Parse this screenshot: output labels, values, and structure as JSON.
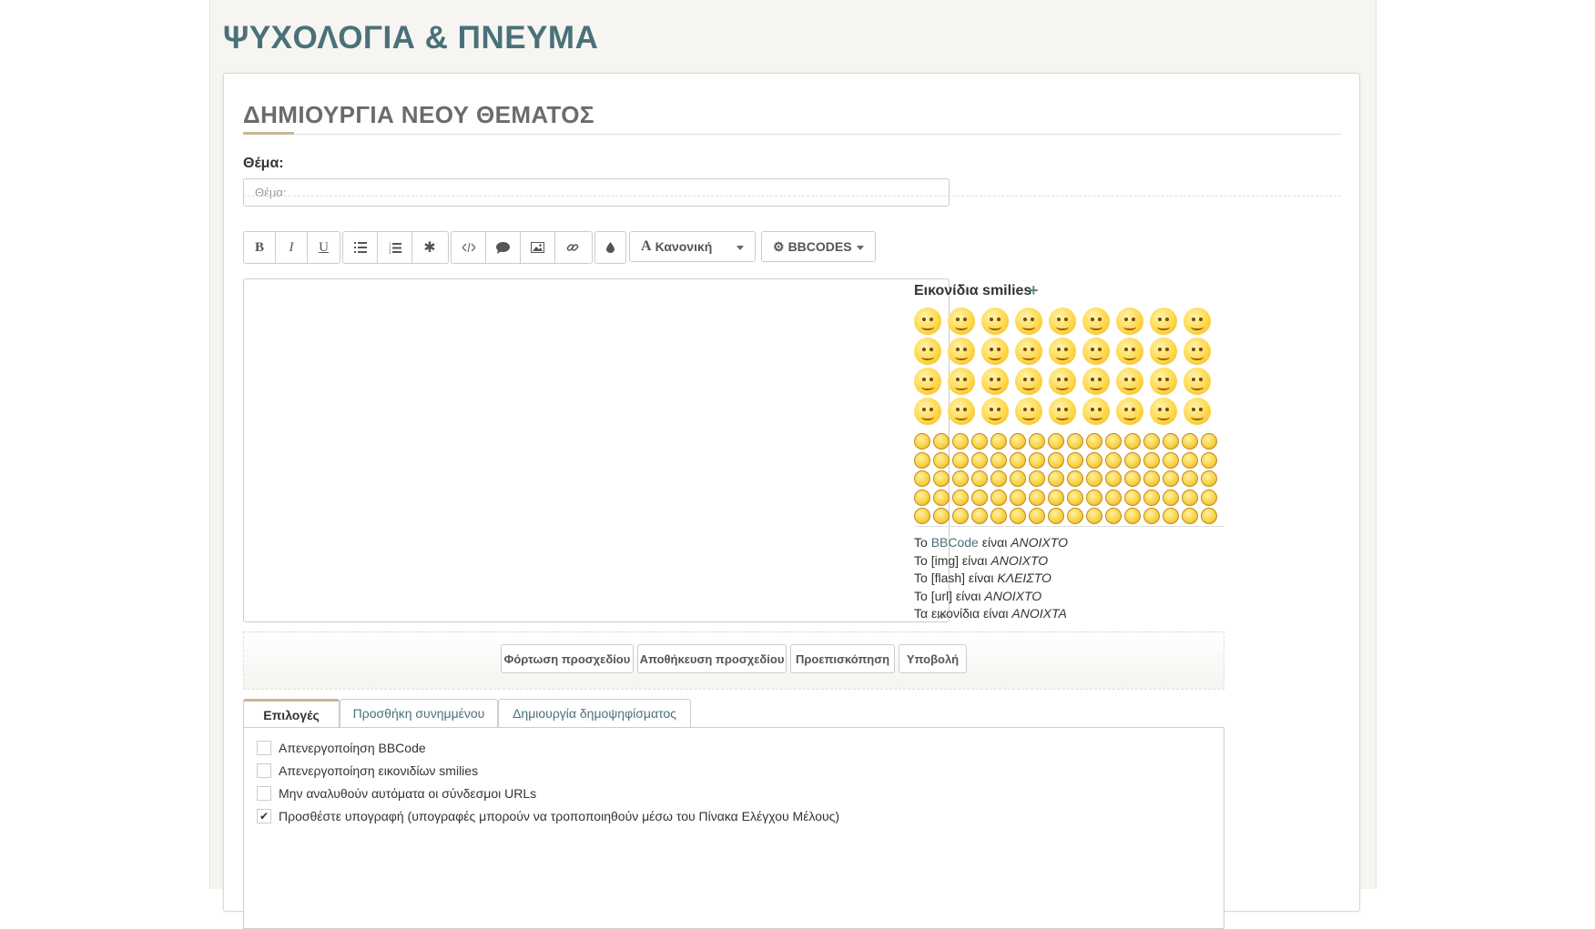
{
  "forum": {
    "title": "ΨΥΧΟΛΟΓΙΑ & ΠΝΕΥΜΑ"
  },
  "panel": {
    "heading": "ΔΗΜΙΟΥΡΓΙΑ ΝΕΟΥ ΘΕΜΑΤΟΣ"
  },
  "subject": {
    "label": "Θέμα:",
    "placeholder": "Θέμα:",
    "value": ""
  },
  "toolbar": {
    "bold": "B",
    "italic": "I",
    "underline": "U",
    "list_icon": "list-icon",
    "ordered_list_icon": "ordered-list-icon",
    "list_item_icon": "asterisk-icon",
    "code_icon": "code-icon",
    "quote_icon": "quote-icon",
    "image_icon": "image-icon",
    "link_icon": "link-icon",
    "color_icon": "drop-icon",
    "font_size_label": "Κανονική",
    "bbcodes_label": "BBCODES"
  },
  "smilies": {
    "title": "Εικονίδια smilies",
    "add_symbol": "+"
  },
  "rules": {
    "line1_prefix": "Το ",
    "line1_link": "BBCode",
    "line1_mid": " είναι ",
    "line1_state": "ΑΝΟΙΧΤΟ",
    "line2_prefix": "Το [img] είναι ",
    "line2_state": "ΑΝΟΙΧΤΟ",
    "line3_prefix": "Το [flash] είναι ",
    "line3_state": "ΚΛΕΙΣΤΟ",
    "line4_prefix": "Το [url] είναι ",
    "line4_state": "ΑΝΟΙΧΤΟ",
    "line5_prefix": "Τα εικονίδια είναι ",
    "line5_state": "ΑΝΟΙΧΤΑ"
  },
  "actions": {
    "load_draft": "Φόρτωση προσχεδίου",
    "save_draft": "Αποθήκευση προσχεδίου",
    "preview": "Προεπισκόπηση",
    "submit": "Υποβολή"
  },
  "tabs": [
    {
      "label": "Επιλογές",
      "active": true
    },
    {
      "label": "Προσθήκη συνημμένου",
      "active": false
    },
    {
      "label": "Δημιουργία δημοψηφίσματος",
      "active": false
    }
  ],
  "options": [
    {
      "label": "Απενεργοποίηση BBCode",
      "checked": false
    },
    {
      "label": "Απενεργοποίηση εικονιδίων smilies",
      "checked": false
    },
    {
      "label": "Μην αναλυθούν αυτόματα οι σύνδεσμοι URLs",
      "checked": false
    },
    {
      "label": "Προσθέστε υπογραφή (υπογραφές μπορούν να τροποποιηθούν μέσω του Πίνακα Ελέγχου Μέλους)",
      "checked": true
    }
  ],
  "colors": {
    "title": "#4a7178",
    "accent": "#c9b794",
    "emoji": "#ffd84a"
  }
}
